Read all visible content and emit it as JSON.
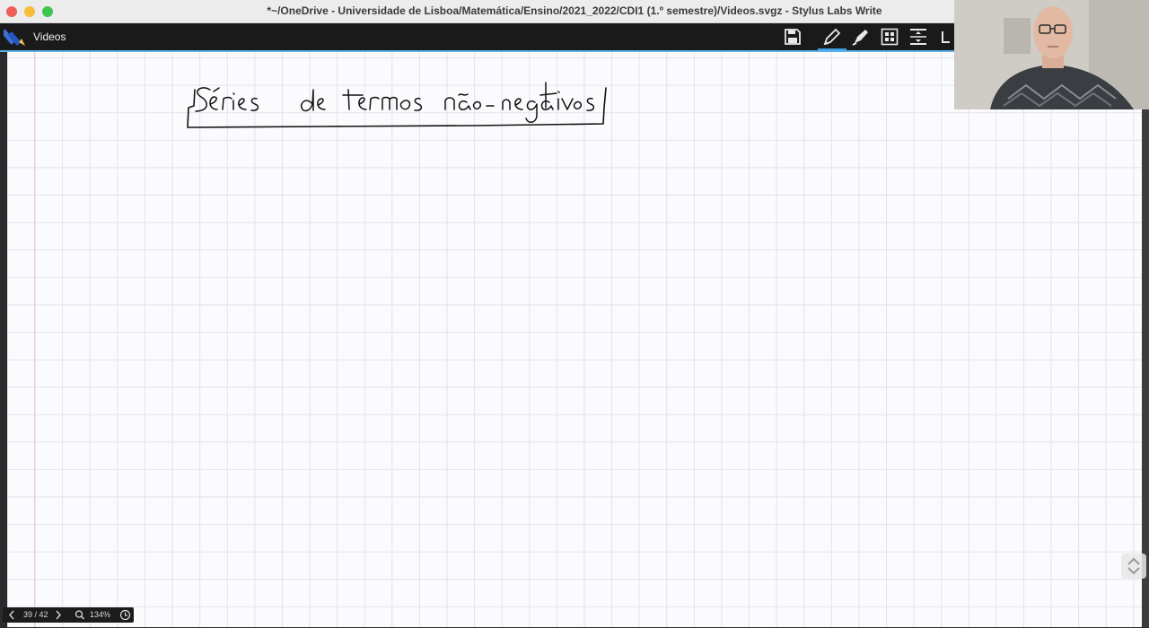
{
  "window": {
    "title": "*~/OneDrive - Universidade de Lisboa/Matemática/Ensino/2021_2022/CDI1 (1.º semestre)/Videos.svgz - Stylus Labs Write"
  },
  "toolbar": {
    "document_name": "Videos",
    "tools": [
      "save-icon",
      "pen-icon",
      "highlighter-icon",
      "select-icon",
      "insert-space-icon"
    ]
  },
  "page": {
    "heading": "Séries de termos não-negativos"
  },
  "status_bar": {
    "page_indicator": "39 / 42",
    "zoom": "134%"
  },
  "colors": {
    "accent": "#3ea0e8",
    "toolbar_bg": "#1a1a1a",
    "ink": "#111111"
  }
}
